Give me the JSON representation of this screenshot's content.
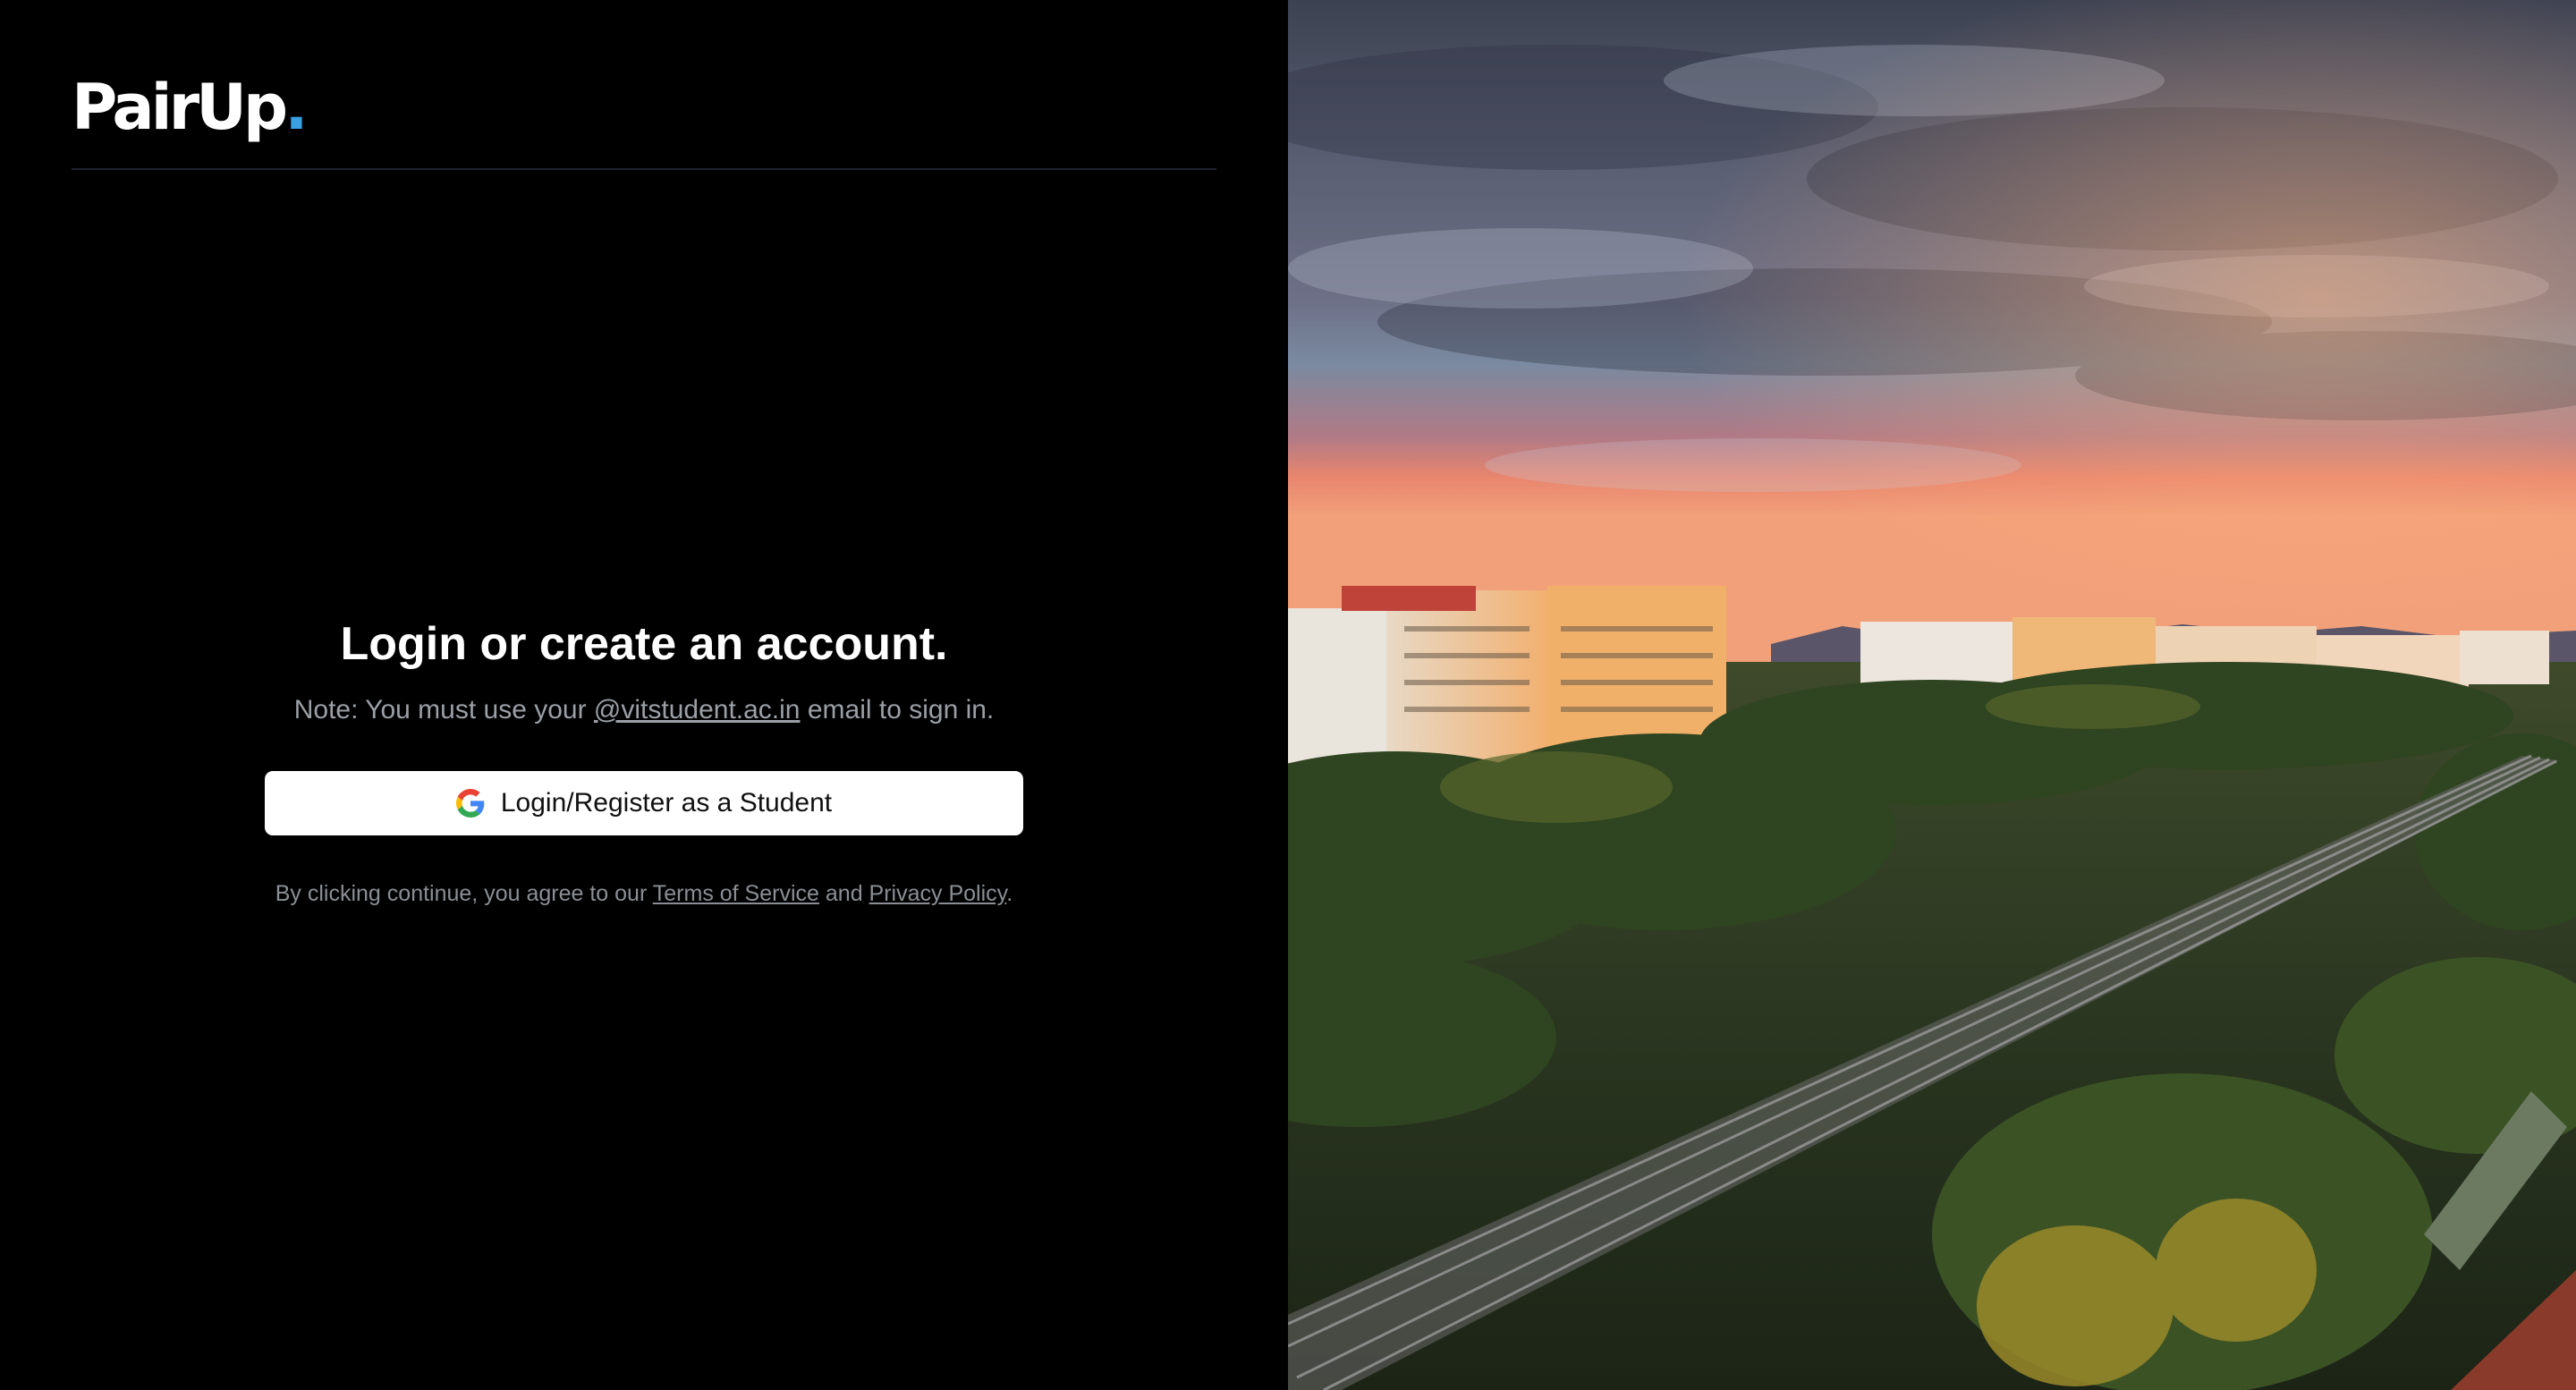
{
  "brand": {
    "name": "PairUp",
    "dot": "."
  },
  "login": {
    "heading": "Login or create an account.",
    "note_prefix": "Note: You must use your ",
    "note_domain": "@vitstudent.ac.in",
    "note_suffix": " email to sign in.",
    "button_label": "Login/Register as a Student",
    "button_icon": "google-icon"
  },
  "legal": {
    "prefix": "By clicking continue, you agree to our ",
    "terms": "Terms of Service",
    "and": " and ",
    "privacy": "Privacy Policy",
    "suffix": "."
  },
  "colors": {
    "background": "#000000",
    "accent_dot": "#3aa0e0",
    "button_bg": "#ffffff",
    "muted_text": "#9aa0a6"
  }
}
